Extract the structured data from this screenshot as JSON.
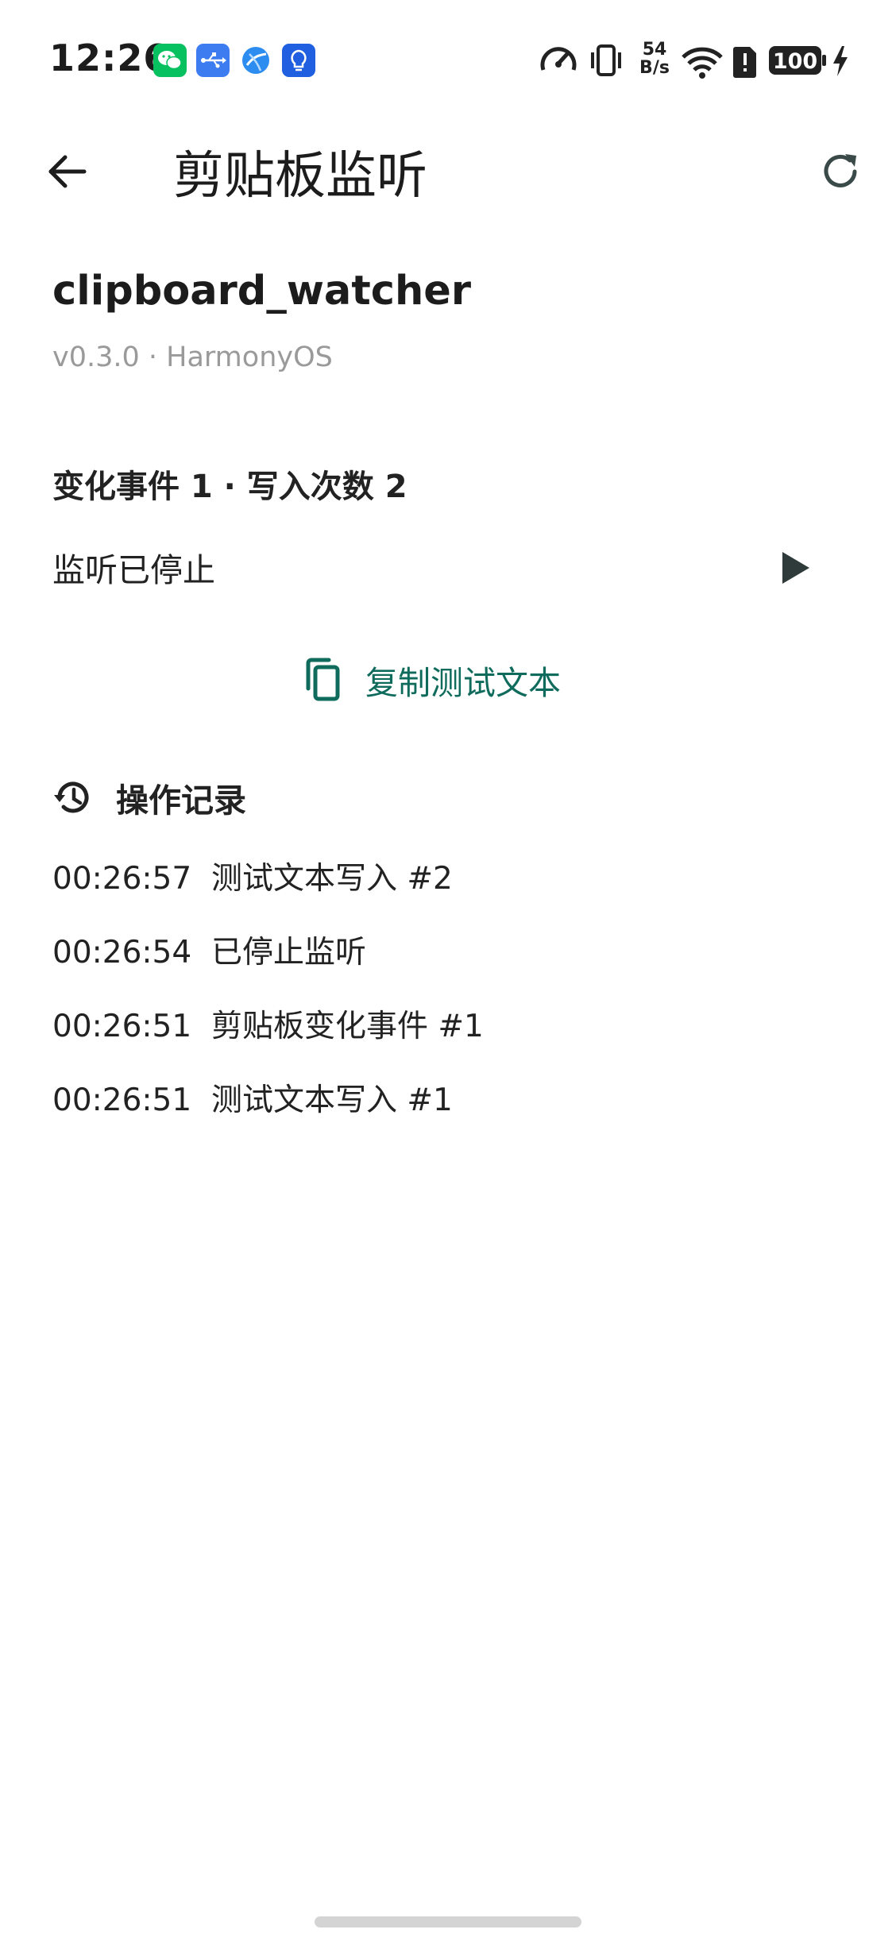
{
  "status_bar": {
    "time": "12:26",
    "net_speed_value": "54",
    "net_speed_unit": "B/s",
    "battery": "100",
    "notification_icons": [
      "wechat-icon",
      "usb-icon",
      "browser-icon",
      "bulb-app-icon"
    ],
    "system_icons": [
      "data-saver-icon",
      "vibrate-icon",
      "net-speed-icon",
      "wifi-icon",
      "sim-alert-icon",
      "battery-icon",
      "charging-icon"
    ]
  },
  "toolbar": {
    "title": "剪贴板监听",
    "back_icon": "arrow-left-icon",
    "refresh_icon": "refresh-icon"
  },
  "plugin": {
    "name": "clipboard_watcher",
    "meta": "v0.3.0 · HarmonyOS"
  },
  "summary": {
    "counts": "变化事件 1 · 写入次数 2"
  },
  "listen": {
    "status": "监听已停止",
    "play_icon": "play-icon"
  },
  "copy_button": {
    "label": "复制测试文本",
    "icon": "copy-icon"
  },
  "log": {
    "title": "操作记录",
    "icon": "history-icon",
    "items": [
      {
        "time": "00:26:57",
        "text": "测试文本写入 #2"
      },
      {
        "time": "00:26:54",
        "text": "已停止监听"
      },
      {
        "time": "00:26:51",
        "text": "剪贴板变化事件 #1"
      },
      {
        "time": "00:26:51",
        "text": "测试文本写入 #1"
      }
    ]
  },
  "colors": {
    "accent": "#0f6b5c",
    "text_primary": "#1c1c1c",
    "text_secondary": "#9a9a9a",
    "wechat_green": "#07c160",
    "blue_icon": "#3d7cf0"
  }
}
